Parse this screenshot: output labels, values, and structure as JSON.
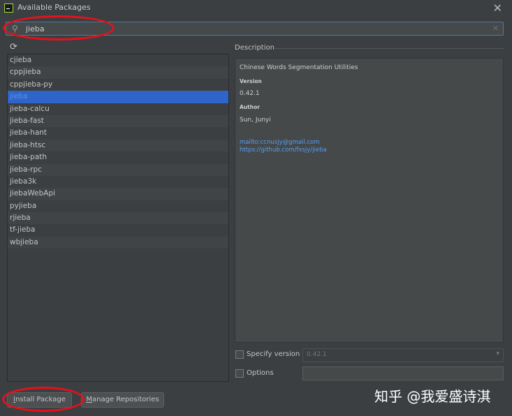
{
  "window": {
    "title": "Available Packages"
  },
  "search": {
    "value": "jieba"
  },
  "packages": [
    "cjieba",
    "cppjieba",
    "cppjieba-py",
    "jieba",
    "jieba-calcu",
    "jieba-fast",
    "jieba-hant",
    "jieba-htsc",
    "jieba-path",
    "jieba-rpc",
    "jieba3k",
    "jiebaWebApi",
    "pyjieba",
    "rjieba",
    "tf-jieba",
    "wbjieba"
  ],
  "selected_package": "jieba",
  "description": {
    "label": "Description",
    "summary": "Chinese Words Segmentation Utilities",
    "version_label": "Version",
    "version": "0.42.1",
    "author_label": "Author",
    "author": "Sun, Junyi",
    "email_link": "mailto:ccnusjy@gmail.com",
    "homepage_link": "https://github.com/fxsjy/jieba"
  },
  "options": {
    "specify_version_label": "Specify version",
    "specify_version_checked": false,
    "version_value": "0.42.1",
    "options_label": "Options",
    "options_checked": false,
    "options_value": ""
  },
  "buttons": {
    "install": "Install Package",
    "manage": "Manage Repositories"
  },
  "watermark": "知乎 @我爱盛诗淇",
  "colors": {
    "background": "#3c3f41",
    "selection": "#2f65ca",
    "link": "#589df6",
    "annotation": "#e8101c",
    "search_border": "#4e79a8"
  }
}
